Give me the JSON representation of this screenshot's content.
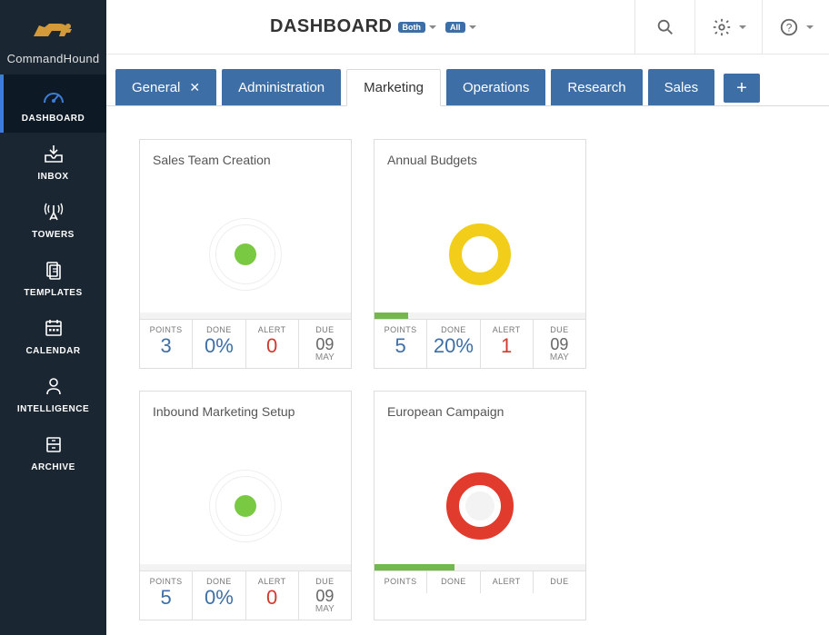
{
  "brand": {
    "name": "CommandHound"
  },
  "sidebar": {
    "items": [
      {
        "label": "DASHBOARD",
        "icon": "gauge"
      },
      {
        "label": "INBOX",
        "icon": "inbox"
      },
      {
        "label": "TOWERS",
        "icon": "tower"
      },
      {
        "label": "TEMPLATES",
        "icon": "templates"
      },
      {
        "label": "CALENDAR",
        "icon": "calendar"
      },
      {
        "label": "INTELLIGENCE",
        "icon": "intelligence"
      },
      {
        "label": "ARCHIVE",
        "icon": "archive"
      }
    ],
    "activeIndex": 0
  },
  "header": {
    "title": "DASHBOARD",
    "filter1": "Both",
    "filter2": "All"
  },
  "tabs": {
    "items": [
      {
        "label": "General",
        "closable": true
      },
      {
        "label": "Administration"
      },
      {
        "label": "Marketing"
      },
      {
        "label": "Operations"
      },
      {
        "label": "Research"
      },
      {
        "label": "Sales"
      }
    ],
    "activeIndex": 2,
    "addLabel": "+"
  },
  "statLabels": {
    "points": "POINTS",
    "done": "DONE",
    "alert": "ALERT",
    "due": "DUE"
  },
  "cards": [
    {
      "title": "Sales Team Creation",
      "gauge": "green",
      "progress": 0,
      "points": "3",
      "done": "0%",
      "alert": "0",
      "dueDay": "09",
      "dueMonth": "MAY"
    },
    {
      "title": "Annual Budgets",
      "gauge": "yellow",
      "progress": 16,
      "points": "5",
      "done": "20%",
      "alert": "1",
      "dueDay": "09",
      "dueMonth": "MAY"
    },
    {
      "title": "Inbound Marketing Setup",
      "gauge": "green",
      "progress": 0,
      "points": "5",
      "done": "0%",
      "alert": "0",
      "dueDay": "09",
      "dueMonth": "MAY"
    },
    {
      "title": "European Campaign",
      "gauge": "red",
      "progress": 38,
      "points": "",
      "done": "",
      "alert": "",
      "dueDay": "",
      "dueMonth": ""
    }
  ]
}
